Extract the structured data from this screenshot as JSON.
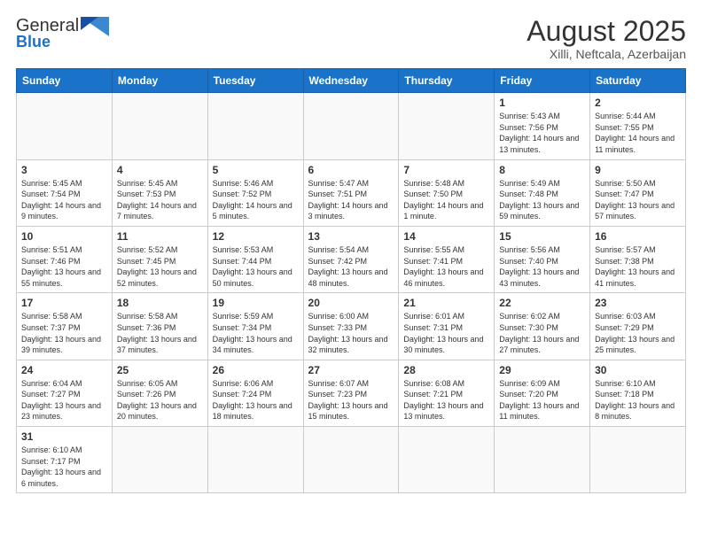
{
  "logo": {
    "text_normal": "General",
    "text_blue": "Blue"
  },
  "title": "August 2025",
  "subtitle": "Xilli, Neftcala, Azerbaijan",
  "days_of_week": [
    "Sunday",
    "Monday",
    "Tuesday",
    "Wednesday",
    "Thursday",
    "Friday",
    "Saturday"
  ],
  "weeks": [
    [
      {
        "day": "",
        "info": ""
      },
      {
        "day": "",
        "info": ""
      },
      {
        "day": "",
        "info": ""
      },
      {
        "day": "",
        "info": ""
      },
      {
        "day": "",
        "info": ""
      },
      {
        "day": "1",
        "info": "Sunrise: 5:43 AM\nSunset: 7:56 PM\nDaylight: 14 hours and 13 minutes."
      },
      {
        "day": "2",
        "info": "Sunrise: 5:44 AM\nSunset: 7:55 PM\nDaylight: 14 hours and 11 minutes."
      }
    ],
    [
      {
        "day": "3",
        "info": "Sunrise: 5:45 AM\nSunset: 7:54 PM\nDaylight: 14 hours and 9 minutes."
      },
      {
        "day": "4",
        "info": "Sunrise: 5:45 AM\nSunset: 7:53 PM\nDaylight: 14 hours and 7 minutes."
      },
      {
        "day": "5",
        "info": "Sunrise: 5:46 AM\nSunset: 7:52 PM\nDaylight: 14 hours and 5 minutes."
      },
      {
        "day": "6",
        "info": "Sunrise: 5:47 AM\nSunset: 7:51 PM\nDaylight: 14 hours and 3 minutes."
      },
      {
        "day": "7",
        "info": "Sunrise: 5:48 AM\nSunset: 7:50 PM\nDaylight: 14 hours and 1 minute."
      },
      {
        "day": "8",
        "info": "Sunrise: 5:49 AM\nSunset: 7:48 PM\nDaylight: 13 hours and 59 minutes."
      },
      {
        "day": "9",
        "info": "Sunrise: 5:50 AM\nSunset: 7:47 PM\nDaylight: 13 hours and 57 minutes."
      }
    ],
    [
      {
        "day": "10",
        "info": "Sunrise: 5:51 AM\nSunset: 7:46 PM\nDaylight: 13 hours and 55 minutes."
      },
      {
        "day": "11",
        "info": "Sunrise: 5:52 AM\nSunset: 7:45 PM\nDaylight: 13 hours and 52 minutes."
      },
      {
        "day": "12",
        "info": "Sunrise: 5:53 AM\nSunset: 7:44 PM\nDaylight: 13 hours and 50 minutes."
      },
      {
        "day": "13",
        "info": "Sunrise: 5:54 AM\nSunset: 7:42 PM\nDaylight: 13 hours and 48 minutes."
      },
      {
        "day": "14",
        "info": "Sunrise: 5:55 AM\nSunset: 7:41 PM\nDaylight: 13 hours and 46 minutes."
      },
      {
        "day": "15",
        "info": "Sunrise: 5:56 AM\nSunset: 7:40 PM\nDaylight: 13 hours and 43 minutes."
      },
      {
        "day": "16",
        "info": "Sunrise: 5:57 AM\nSunset: 7:38 PM\nDaylight: 13 hours and 41 minutes."
      }
    ],
    [
      {
        "day": "17",
        "info": "Sunrise: 5:58 AM\nSunset: 7:37 PM\nDaylight: 13 hours and 39 minutes."
      },
      {
        "day": "18",
        "info": "Sunrise: 5:58 AM\nSunset: 7:36 PM\nDaylight: 13 hours and 37 minutes."
      },
      {
        "day": "19",
        "info": "Sunrise: 5:59 AM\nSunset: 7:34 PM\nDaylight: 13 hours and 34 minutes."
      },
      {
        "day": "20",
        "info": "Sunrise: 6:00 AM\nSunset: 7:33 PM\nDaylight: 13 hours and 32 minutes."
      },
      {
        "day": "21",
        "info": "Sunrise: 6:01 AM\nSunset: 7:31 PM\nDaylight: 13 hours and 30 minutes."
      },
      {
        "day": "22",
        "info": "Sunrise: 6:02 AM\nSunset: 7:30 PM\nDaylight: 13 hours and 27 minutes."
      },
      {
        "day": "23",
        "info": "Sunrise: 6:03 AM\nSunset: 7:29 PM\nDaylight: 13 hours and 25 minutes."
      }
    ],
    [
      {
        "day": "24",
        "info": "Sunrise: 6:04 AM\nSunset: 7:27 PM\nDaylight: 13 hours and 23 minutes."
      },
      {
        "day": "25",
        "info": "Sunrise: 6:05 AM\nSunset: 7:26 PM\nDaylight: 13 hours and 20 minutes."
      },
      {
        "day": "26",
        "info": "Sunrise: 6:06 AM\nSunset: 7:24 PM\nDaylight: 13 hours and 18 minutes."
      },
      {
        "day": "27",
        "info": "Sunrise: 6:07 AM\nSunset: 7:23 PM\nDaylight: 13 hours and 15 minutes."
      },
      {
        "day": "28",
        "info": "Sunrise: 6:08 AM\nSunset: 7:21 PM\nDaylight: 13 hours and 13 minutes."
      },
      {
        "day": "29",
        "info": "Sunrise: 6:09 AM\nSunset: 7:20 PM\nDaylight: 13 hours and 11 minutes."
      },
      {
        "day": "30",
        "info": "Sunrise: 6:10 AM\nSunset: 7:18 PM\nDaylight: 13 hours and 8 minutes."
      }
    ],
    [
      {
        "day": "31",
        "info": "Sunrise: 6:10 AM\nSunset: 7:17 PM\nDaylight: 13 hours and 6 minutes."
      },
      {
        "day": "",
        "info": ""
      },
      {
        "day": "",
        "info": ""
      },
      {
        "day": "",
        "info": ""
      },
      {
        "day": "",
        "info": ""
      },
      {
        "day": "",
        "info": ""
      },
      {
        "day": "",
        "info": ""
      }
    ]
  ]
}
